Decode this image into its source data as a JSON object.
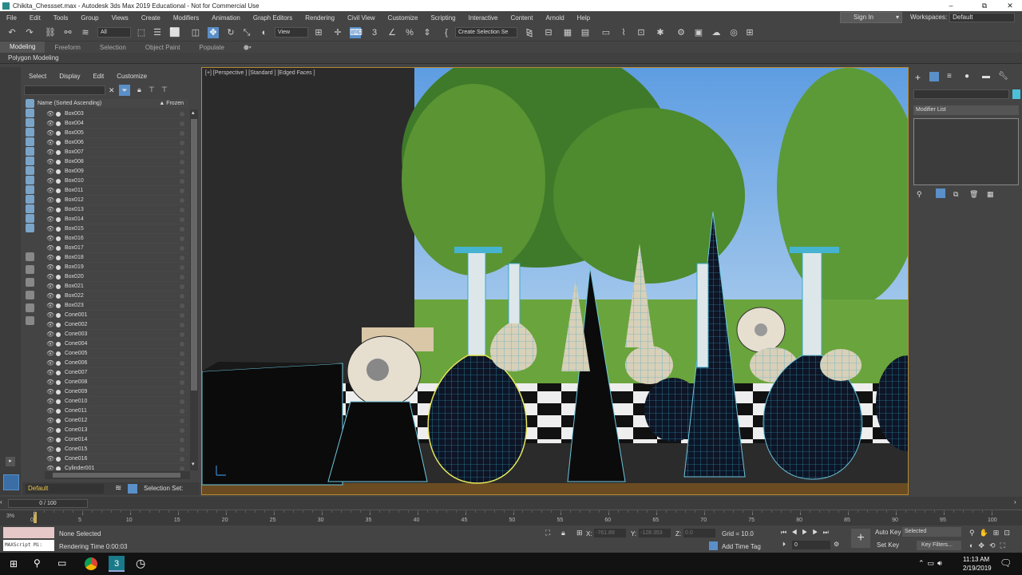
{
  "title_bar": {
    "title": "Chikita_Chessset.max - Autodesk 3ds Max 2019 Educational - Not for Commercial Use",
    "minimize": "–",
    "maximize": "⧉",
    "close": "✕"
  },
  "menu": [
    "File",
    "Edit",
    "Tools",
    "Group",
    "Views",
    "Create",
    "Modifiers",
    "Animation",
    "Graph Editors",
    "Rendering",
    "Civil View",
    "Customize",
    "Scripting",
    "Interactive",
    "Content",
    "Arnold",
    "Help"
  ],
  "signin": {
    "label": "Sign In"
  },
  "workspace": {
    "label": "Workspaces:",
    "value": "Default"
  },
  "toolbar": {
    "selection_filter": "All",
    "ref_coord": "View",
    "named_sel": "Create Selection Se"
  },
  "ribbon": {
    "tabs": [
      "Modeling",
      "Freeform",
      "Selection",
      "Object Paint",
      "Populate"
    ],
    "sub": "Polygon Modeling"
  },
  "scene_explorer": {
    "menu": [
      "Select",
      "Display",
      "Edit",
      "Customize"
    ],
    "col_name": "Name (Sorted Ascending)",
    "col_frozen": "▲ Frozen",
    "items": [
      "Box003",
      "Box004",
      "Box005",
      "Box006",
      "Box007",
      "Box008",
      "Box009",
      "Box010",
      "Box011",
      "Box012",
      "Box013",
      "Box014",
      "Box015",
      "Box016",
      "Box017",
      "Box018",
      "Box019",
      "Box020",
      "Box021",
      "Box022",
      "Box023",
      "Cone001",
      "Cone002",
      "Cone003",
      "Cone004",
      "Cone005",
      "Cone006",
      "Cone007",
      "Cone008",
      "Cone009",
      "Cone010",
      "Cone011",
      "Cone012",
      "Cone013",
      "Cone014",
      "Cone015",
      "Cone016",
      "Cylinder001"
    ],
    "layer": "Default",
    "selection_sets": "Selection Set:"
  },
  "viewport": {
    "label": "[+] [Perspective ] [Standard ] [Edged Faces ]"
  },
  "command_panel": {
    "modifier_list": "Modifier List"
  },
  "timeline": {
    "frame": "0 / 100",
    "ticks": [
      "0",
      "5",
      "10",
      "15",
      "20",
      "25",
      "30",
      "35",
      "40",
      "45",
      "50",
      "55",
      "60",
      "65",
      "70",
      "75",
      "80",
      "85",
      "90",
      "95",
      "100"
    ],
    "percent": "3%"
  },
  "status": {
    "maxscript": "MAXScript Mi:",
    "none_selected": "None Selected",
    "render_time": "Rendering Time  0:00:03",
    "x_label": "X:",
    "x_val": "-761.89",
    "y_label": "Y:",
    "y_val": "-128.353",
    "z_label": "Z:",
    "z_val": "0.0",
    "grid": "Grid = 10.0",
    "add_time_tag": "Add Time Tag",
    "auto_key": "Auto Key",
    "set_key": "Set Key",
    "selected": "Selected",
    "key_filters": "Key Filters...",
    "frame_field": "0"
  },
  "taskbar": {
    "time": "11:13 AM",
    "date": "2/19/2019"
  },
  "colors": {
    "accent_blue": "#5a8fc8",
    "viewport_border": "#b58a34",
    "grass": "#6aa43c",
    "sky": "#6aa7e6"
  }
}
